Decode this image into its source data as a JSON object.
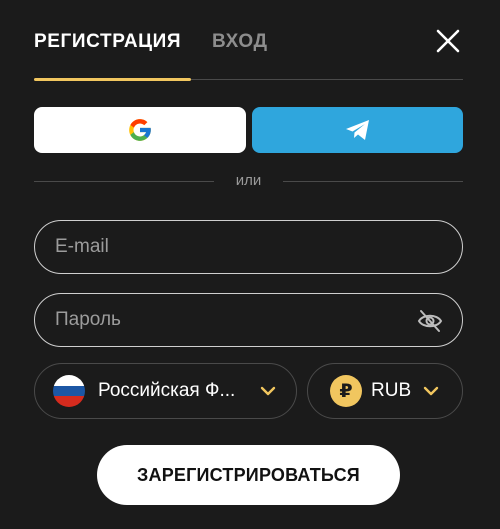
{
  "tabs": {
    "register": "РЕГИСТРАЦИЯ",
    "login": "ВХОД"
  },
  "colors": {
    "background": "#1b1b1b",
    "accent": "#f1c65f",
    "telegram": "#2fa6dd"
  },
  "social": {
    "google_icon": "google-logo-icon",
    "telegram_icon": "telegram-plane-icon"
  },
  "divider_text": "или",
  "fields": {
    "email": {
      "placeholder": "E-mail",
      "value": ""
    },
    "password": {
      "placeholder": "Пароль",
      "value": ""
    }
  },
  "selects": {
    "country": {
      "value": "Российская Ф...",
      "flag": "russia-flag"
    },
    "currency": {
      "value": "RUB",
      "symbol": "₽"
    }
  },
  "submit_label": "ЗАРЕГИСТРИРОВАТЬСЯ"
}
